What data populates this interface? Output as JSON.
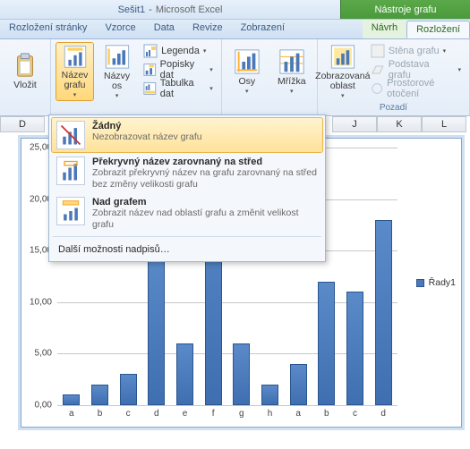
{
  "title": {
    "doc": "Sešit1",
    "sep": "-",
    "app": "Microsoft Excel",
    "context": "Nástroje grafu"
  },
  "tabs": {
    "items": [
      "Rozložení stránky",
      "Vzorce",
      "Data",
      "Revize",
      "Zobrazení"
    ],
    "context": [
      "Návrh",
      "Rozložení"
    ],
    "active": "Rozložení"
  },
  "ribbon": {
    "paste": "Vložit",
    "chartTitle": "Název\ngrafu",
    "axisTitles": "Názvy\nos",
    "legend": "Legenda",
    "dataLabels": "Popisky dat",
    "dataTable": "Tabulka dat",
    "axes": "Osy",
    "gridlines": "Mřížka",
    "plotArea": "Zobrazovaná\noblast",
    "chartWall": "Stěna grafu",
    "chartFloor": "Podstava grafu",
    "rotation3d": "Prostorové otočení",
    "bgGroup": "Pozadí"
  },
  "menu": {
    "none": {
      "title": "Žádný",
      "desc": "Nezobrazovat název grafu"
    },
    "overlay": {
      "title": "Překryvný název zarovnaný na střed",
      "desc": "Zobrazit překryvný název na grafu zarovnaný na střed bez změny velikosti grafu"
    },
    "above": {
      "title": "Nad grafem",
      "desc": "Zobrazit název nad oblastí grafu a změnit velikost grafu"
    },
    "more": "Další možnosti nadpisů…"
  },
  "columns": [
    "D",
    "J",
    "K",
    "L"
  ],
  "chart_data": {
    "type": "bar",
    "title": "",
    "xlabel": "",
    "ylabel": "",
    "ylim": [
      0,
      25
    ],
    "yticks": [
      0,
      5,
      10,
      15,
      20,
      25
    ],
    "yticklabels": [
      "0,00",
      "5,00",
      "10,00",
      "15,00",
      "20,00",
      "25,00"
    ],
    "categories": [
      "a",
      "b",
      "c",
      "d",
      "e",
      "f",
      "g",
      "h",
      "a",
      "b",
      "c",
      "d"
    ],
    "series": [
      {
        "name": "Řady1",
        "values": [
          1,
          2,
          3,
          15,
          6,
          23,
          6,
          2,
          4,
          12,
          11,
          18
        ]
      }
    ]
  }
}
